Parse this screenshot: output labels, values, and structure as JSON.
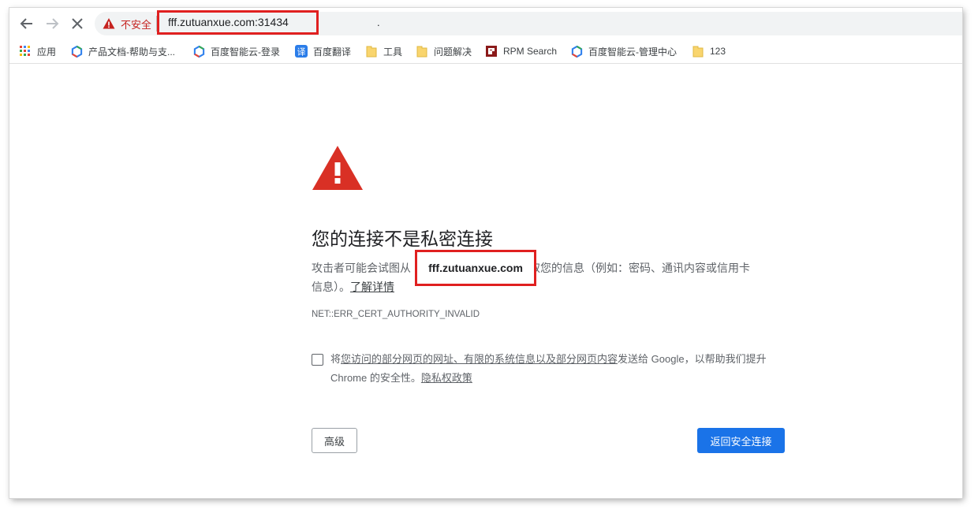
{
  "toolbar": {
    "security_label": "不安全",
    "url": "fff.zutuanxue.com:31434",
    "url_suffix": "."
  },
  "bookmarks": [
    {
      "label": "应用",
      "icon": "apps-grid-icon"
    },
    {
      "label": "产品文档-帮助与支...",
      "icon": "baidu-cloud-icon"
    },
    {
      "label": "百度智能云-登录",
      "icon": "baidu-cloud-icon"
    },
    {
      "label": "百度翻译",
      "icon": "translate-icon"
    },
    {
      "label": "工具",
      "icon": "folder-icon"
    },
    {
      "label": "问题解决",
      "icon": "folder-icon"
    },
    {
      "label": "RPM Search",
      "icon": "rpm-icon"
    },
    {
      "label": "百度智能云-管理中心",
      "icon": "baidu-cloud-icon"
    },
    {
      "label": "123",
      "icon": "folder-icon"
    }
  ],
  "interstitial": {
    "title": "您的连接不是私密连接",
    "para_prefix": "攻击者可能会试图从",
    "host": "fff.zutuanxue.com",
    "para_suffix": "窃取您的信息（例如：密码、通讯内容或信用卡",
    "para_line2": "信息）。",
    "learn_more": "了解详情",
    "error_code": "NET::ERR_CERT_AUTHORITY_INVALID",
    "optin_prefix": "将",
    "optin_link1": "您访问的部分网页的网址、有限的系统信息以及部分网页内容",
    "optin_middle": "发送给 Google，以帮助我们提升 Chrome 的安全性。",
    "optin_link2": "隐私权政策",
    "advanced_button": "高级",
    "back_button": "返回安全连接"
  },
  "colors": {
    "accent": "#1a73e8",
    "warning_red": "#d93025",
    "highlight_red": "#e02020"
  }
}
